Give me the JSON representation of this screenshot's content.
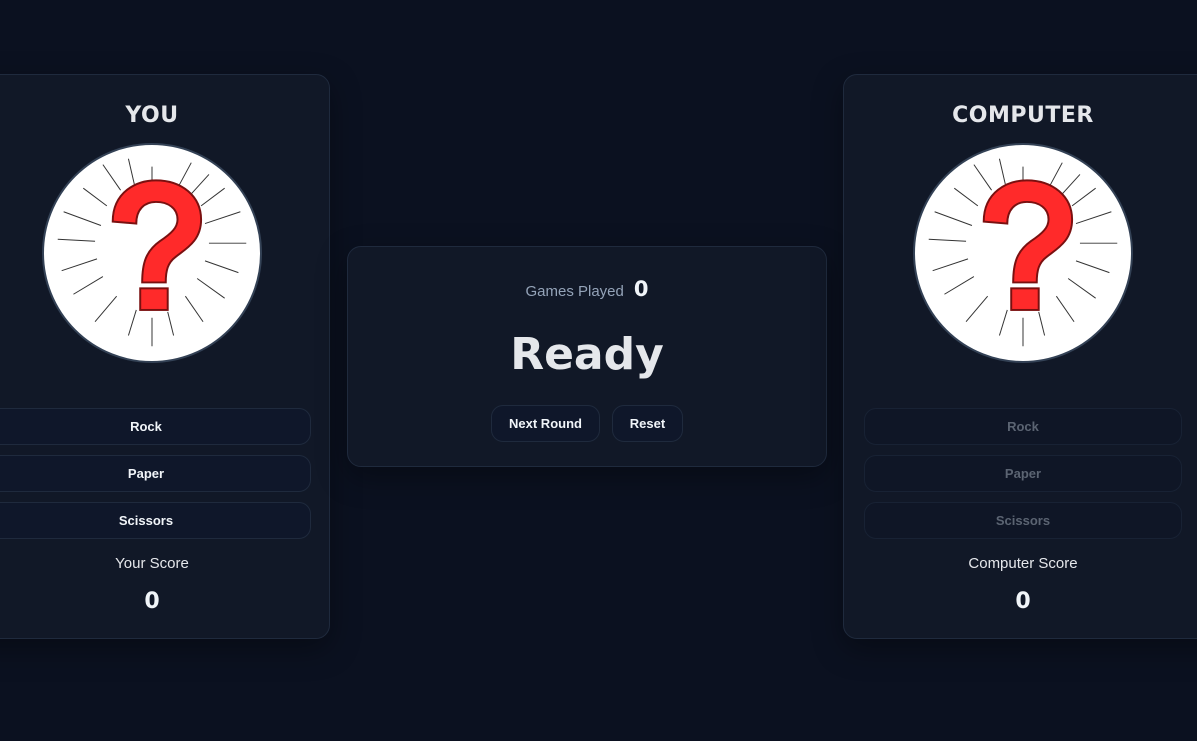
{
  "player": {
    "title": "YOU",
    "avatar_icon": "question-mark-icon",
    "choices": [
      "Rock",
      "Paper",
      "Scissors"
    ],
    "score_label": "Your Score",
    "score": "0"
  },
  "computer": {
    "title": "COMPUTER",
    "avatar_icon": "question-mark-icon",
    "choices": [
      "Rock",
      "Paper",
      "Scissors"
    ],
    "score_label": "Computer Score",
    "score": "0"
  },
  "center": {
    "games_played_label": "Games Played",
    "games_played": "0",
    "status": "Ready",
    "next_round_label": "Next Round",
    "reset_label": "Reset"
  },
  "colors": {
    "background": "#0b1120",
    "card": "#111827",
    "accent_red": "#ff2a2a",
    "text": "#e5e7eb",
    "muted": "#94a3b8"
  }
}
